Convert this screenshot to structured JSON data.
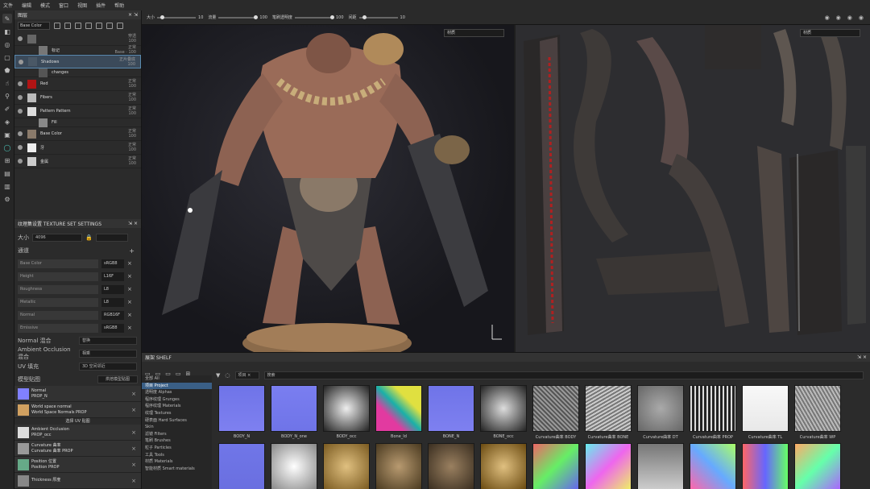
{
  "menu": [
    "文件",
    "编辑",
    "模式",
    "窗口",
    "视图",
    "插件",
    "帮助"
  ],
  "layers": {
    "title": "图层",
    "channel": "Base Color",
    "items": [
      {
        "name": "",
        "blend": "穿透",
        "opacity": "100",
        "thumb": "#666"
      },
      {
        "name": "标记",
        "blend": "正常",
        "opacity": "Base · 100",
        "thumb": "#777",
        "sub": true
      },
      {
        "name": "Shadows",
        "blend": "正片叠底",
        "opacity": "100",
        "thumb": "#4a5866",
        "selected": true
      },
      {
        "name": "changes",
        "blend": "",
        "opacity": "",
        "thumb": "#555",
        "sub": true
      },
      {
        "name": "Red",
        "blend": "正常",
        "opacity": "100",
        "thumb": "#b01414"
      },
      {
        "name": "Fibers",
        "blend": "正常",
        "opacity": "100",
        "thumb": "#bbb"
      },
      {
        "name": "Pattern Pattern",
        "blend": "正常",
        "opacity": "100",
        "thumb": "#ddd"
      },
      {
        "name": "Fill",
        "blend": "",
        "opacity": "",
        "thumb": "#888",
        "sub": true
      },
      {
        "name": "Base Color",
        "blend": "正常",
        "opacity": "100",
        "thumb": "#8a7a6a"
      },
      {
        "name": "牙",
        "blend": "正常",
        "opacity": "100",
        "thumb": "#eee"
      },
      {
        "name": "金属",
        "blend": "正常",
        "opacity": "100",
        "thumb": "#ccc"
      }
    ]
  },
  "texture_set": {
    "title": "纹理集设置 TEXTURE SET SETTINGS",
    "size_label": "大小",
    "size": "4096",
    "channels_label": "通道",
    "channels": [
      {
        "name": "Base Color",
        "format": "sRGB8"
      },
      {
        "name": "Height",
        "format": "L16F"
      },
      {
        "name": "Roughness",
        "format": "L8"
      },
      {
        "name": "Metallic",
        "format": "L8"
      },
      {
        "name": "Normal",
        "format": "RGB16F"
      },
      {
        "name": "Emissive",
        "format": "sRGB8"
      }
    ],
    "normal_label": "Normal 混合",
    "normal_value": "替换",
    "ao_label": "Ambient Occlusion 混合",
    "ao_value": "相乘",
    "uv_label": "UV 填充",
    "uv_value": "3D 空间邻近",
    "maps_label": "模型贴图",
    "bake_button": "烘焙模型贴图",
    "maps": [
      {
        "name": "Normal",
        "file": "PROP_N",
        "color": "#8080ff"
      },
      {
        "name": "World space normal",
        "file": "World Space Normals PROP",
        "color": "#d0a060"
      },
      {
        "name": "Ambient Occlusion",
        "file": "PROP_occ",
        "color": "#ddd"
      },
      {
        "name": "Curvature 曲率",
        "file": "Curvature 曲率 PROP",
        "color": "#999"
      },
      {
        "name": "Position 位置",
        "file": "Position PROP",
        "color": "#6a8"
      },
      {
        "name": "Thickness 厚度",
        "file": "",
        "color": "#888"
      }
    ],
    "select_uv": "选择 UV 贴图"
  },
  "viewport_tools": [
    {
      "label": "大小",
      "value": "10"
    },
    {
      "label": "流量",
      "value": "100"
    },
    {
      "label": "笔刷透明度",
      "value": "100"
    },
    {
      "label": "间距",
      "value": "10"
    }
  ],
  "vp3d_dropdown": "材质",
  "vp2d_dropdown": "材质",
  "shelf": {
    "title": "展架 SHELF",
    "search_placeholder": "搜索",
    "filter_tag": "项目",
    "categories": [
      "全部 All",
      "项目 Project",
      "透明度 Alphas",
      "程序纹理 Grunges",
      "程序纹理 Materials",
      "纹理 Textures",
      "硬表面 Hard Surfaces",
      "Skin",
      "滤镜 Filters",
      "笔刷 Brushes",
      "粒子 Particles",
      "工具 Tools",
      "材质 Materials",
      "智能材质 Smart materials"
    ],
    "items": [
      "BODY_N",
      "BODY_N_one",
      "BODY_occ",
      "Bone_Id",
      "BONE_N",
      "BONE_occ",
      "Curvature曲率 BODY",
      "Curvature曲率 BONE",
      "Curvature曲率 DT",
      "Curvature曲率 PROP",
      "Curvature曲率 TL",
      "Curvature曲率 WP"
    ]
  }
}
